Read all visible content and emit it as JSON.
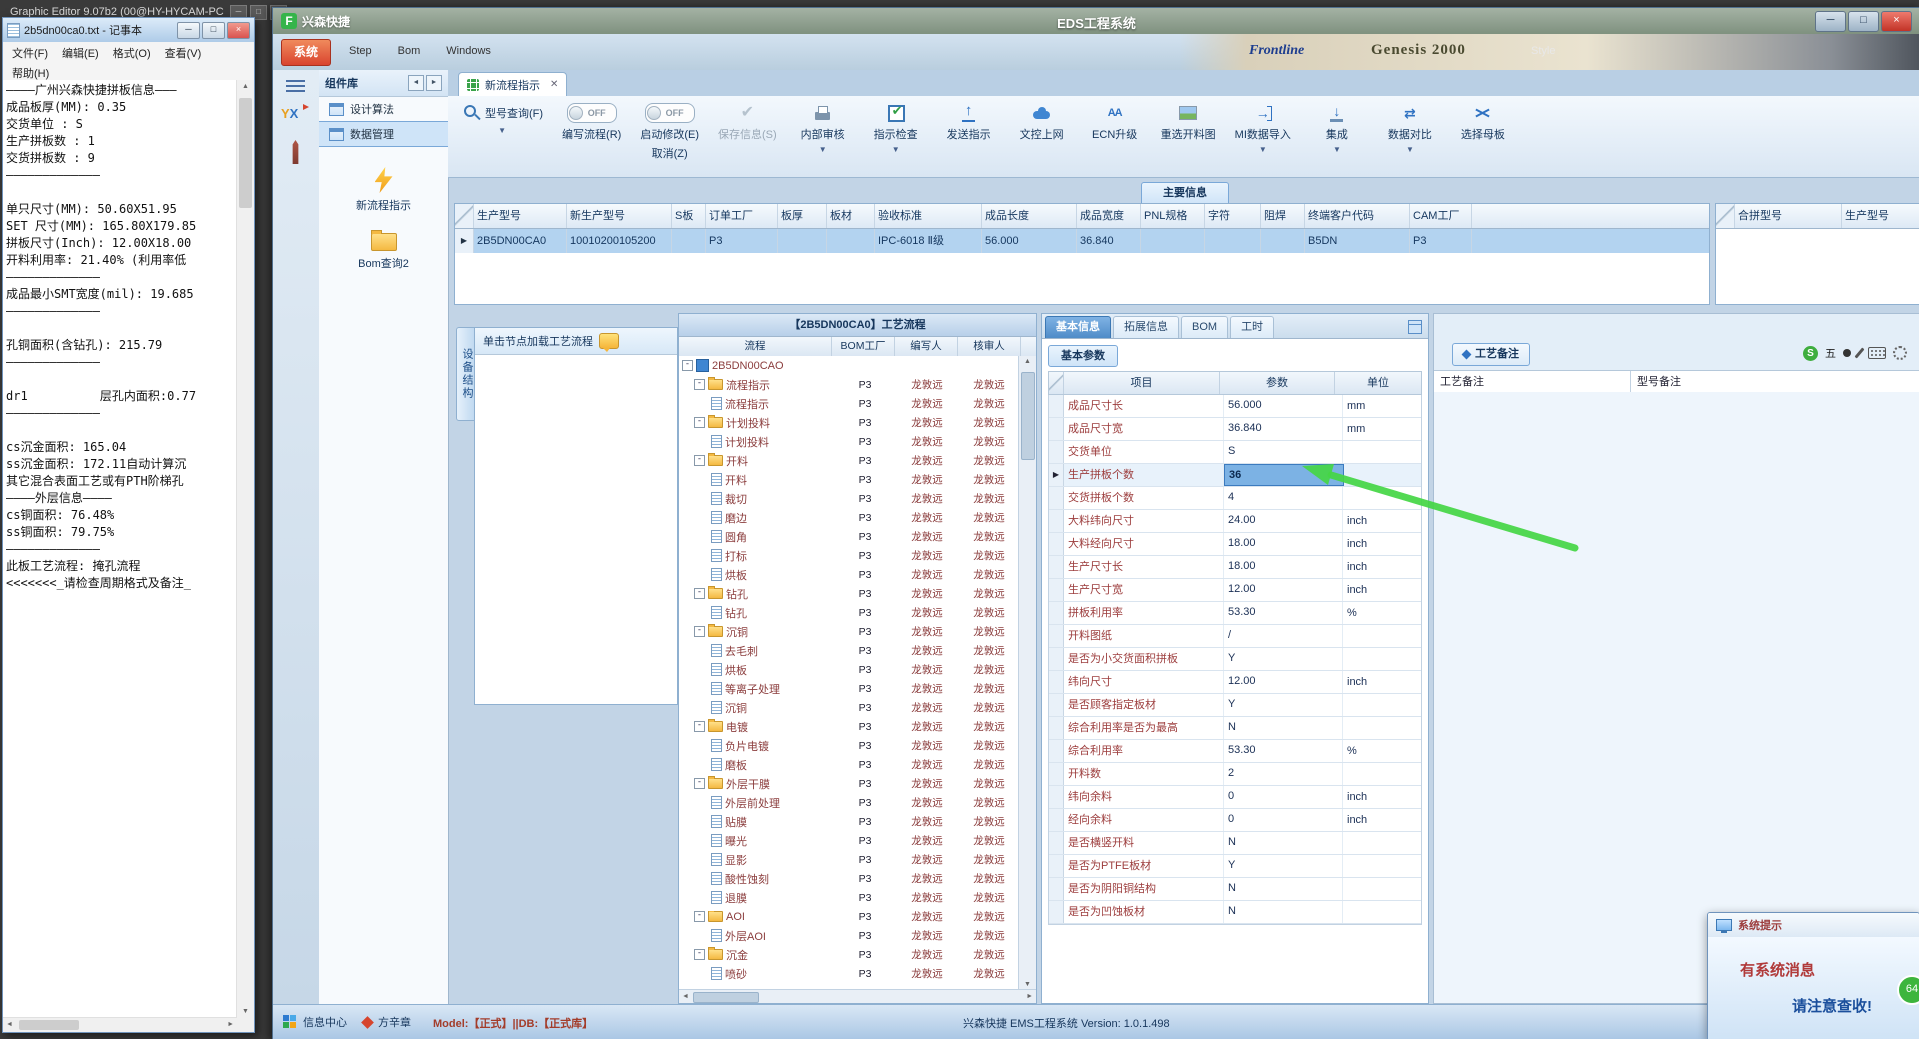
{
  "ge": {
    "title": "Graphic Editor 9.07b2 (00@HY-HYCAM-PC"
  },
  "notepad": {
    "title": "2b5dn00ca0.txt - 记事本",
    "menus": [
      "文件(F)",
      "编辑(E)",
      "格式(O)",
      "查看(V)",
      "帮助(H)"
    ],
    "lines": [
      "————广州兴森快捷拼板信息———",
      "成品板厚(MM): 0.35",
      "交货单位 : S",
      "生产拼板数 : 1",
      "交货拼板数 : 9",
      "—————————————",
      "",
      "单只尺寸(MM): 50.60X51.95",
      "SET 尺寸(MM): 165.80X179.85",
      "拼板尺寸(Inch): 12.00X18.00",
      "开料利用率: 21.40% (利用率低",
      "—————————————",
      "成品最小SMT宽度(mil): 19.685",
      "—————————————",
      "",
      "孔铜面积(含钻孔): 215.79",
      "—————————————",
      "",
      "dr1          层孔内面积:0.77",
      "—————————————",
      "",
      "cs沉金面积: 165.04",
      "ss沉金面积: 172.11自动计算沉",
      "其它混合表面工艺或有PTH阶梯孔",
      "————外层信息————",
      "cs铜面积: 76.48%",
      "ss铜面积: 79.75%",
      "—————————————",
      "此板工艺流程: 掩孔流程",
      "<<<<<<<_请检查周期格式及备注_"
    ]
  },
  "app": {
    "brand_logo": "F",
    "brand": "兴森快捷",
    "title": "EDS工程系统",
    "system_menu": "系统",
    "menu_extras": [
      "Step",
      "Bom",
      "Windows"
    ],
    "banner": {
      "frontline": "Frontline",
      "genesis": "Genesis 2000",
      "style": "Style"
    }
  },
  "library": {
    "title": "组件库",
    "logo_y": "Y",
    "logo_x": "X",
    "tabs": [
      "设计算法",
      "数据管理"
    ],
    "active_tab": "数据管理",
    "items": [
      {
        "label": "新流程指示",
        "icon": "bolt"
      },
      {
        "label": "Bom查询2",
        "icon": "folder"
      }
    ]
  },
  "workspace": {
    "tab": "新流程指示",
    "main_info_label": "主要信息",
    "toolbar": [
      {
        "label": "型号查询(F)",
        "icon": "search",
        "dropdown": true,
        "inline": true
      },
      {
        "label": "编写流程(R)",
        "toggle": "OFF"
      },
      {
        "label": "启动修改(E)",
        "toggle": "OFF",
        "sub": "取消(Z)"
      },
      {
        "label": "保存信息(S)",
        "icon": "save",
        "disabled": true
      },
      {
        "label": "内部审核",
        "icon": "audit",
        "dropdown": true
      },
      {
        "label": "指示检查",
        "icon": "checkbox",
        "dropdown": true
      },
      {
        "label": "发送指示",
        "icon": "send"
      },
      {
        "label": "文控上网",
        "icon": "cloud"
      },
      {
        "label": "ECN升级",
        "icon": "ecn"
      },
      {
        "label": "重选开料图",
        "icon": "image"
      },
      {
        "label": "MI数据导入",
        "icon": "import",
        "dropdown": true
      },
      {
        "label": "集成",
        "icon": "integrate",
        "dropdown": true
      },
      {
        "label": "数据对比",
        "icon": "compare",
        "dropdown": true
      },
      {
        "label": "选择母板",
        "icon": "shuffle"
      }
    ],
    "main_table": {
      "columns": [
        "生产型号",
        "新生产型号",
        "S板",
        "订单工厂",
        "板厚",
        "板材",
        "验收标准",
        "成品长度",
        "成品宽度",
        "PNL规格",
        "字符",
        "阻焊",
        "终端客户代码",
        "CAM工厂"
      ],
      "row": [
        "2B5DN00CA0",
        "10010200105200",
        "",
        "P3",
        "",
        "",
        "IPC-6018 Ⅱ级",
        "56.000",
        "36.840",
        "",
        "",
        "",
        "B5DN",
        "P3"
      ],
      "right_columns": [
        "合拼型号",
        "生产型号"
      ]
    }
  },
  "flow": {
    "device_tab": "设备结构",
    "hint": "单击节点加载工艺流程",
    "title": "【2B5DN00CA0】工艺流程",
    "columns": [
      "流程",
      "BOM工厂",
      "编写人",
      "核审人"
    ],
    "rows": [
      {
        "t": "root",
        "i": 0,
        "l": "2B5DN00CAO",
        "b": "",
        "w": "",
        "a": ""
      },
      {
        "t": "folder",
        "i": 1,
        "l": "流程指示",
        "b": "P3",
        "w": "龙敦远",
        "a": "龙敦远"
      },
      {
        "t": "doc",
        "i": 2,
        "l": "流程指示",
        "b": "P3",
        "w": "龙敦远",
        "a": "龙敦远"
      },
      {
        "t": "folder",
        "i": 1,
        "l": "计划投料",
        "b": "P3",
        "w": "龙敦远",
        "a": "龙敦远"
      },
      {
        "t": "doc",
        "i": 2,
        "l": "计划投料",
        "b": "P3",
        "w": "龙敦远",
        "a": "龙敦远"
      },
      {
        "t": "folder",
        "i": 1,
        "l": "开料",
        "b": "P3",
        "w": "龙敦远",
        "a": "龙敦远"
      },
      {
        "t": "doc",
        "i": 2,
        "l": "开料",
        "b": "P3",
        "w": "龙敦远",
        "a": "龙敦远"
      },
      {
        "t": "doc",
        "i": 2,
        "l": "裁切",
        "b": "P3",
        "w": "龙敦远",
        "a": "龙敦远"
      },
      {
        "t": "doc",
        "i": 2,
        "l": "磨边",
        "b": "P3",
        "w": "龙敦远",
        "a": "龙敦远"
      },
      {
        "t": "doc",
        "i": 2,
        "l": "圆角",
        "b": "P3",
        "w": "龙敦远",
        "a": "龙敦远"
      },
      {
        "t": "doc",
        "i": 2,
        "l": "打标",
        "b": "P3",
        "w": "龙敦远",
        "a": "龙敦远"
      },
      {
        "t": "doc",
        "i": 2,
        "l": "烘板",
        "b": "P3",
        "w": "龙敦远",
        "a": "龙敦远"
      },
      {
        "t": "folder",
        "i": 1,
        "l": "钻孔",
        "b": "P3",
        "w": "龙敦远",
        "a": "龙敦远"
      },
      {
        "t": "doc",
        "i": 2,
        "l": "钻孔",
        "b": "P3",
        "w": "龙敦远",
        "a": "龙敦远"
      },
      {
        "t": "folder",
        "i": 1,
        "l": "沉铜",
        "b": "P3",
        "w": "龙敦远",
        "a": "龙敦远"
      },
      {
        "t": "doc",
        "i": 2,
        "l": "去毛刺",
        "b": "P3",
        "w": "龙敦远",
        "a": "龙敦远"
      },
      {
        "t": "doc",
        "i": 2,
        "l": "烘板",
        "b": "P3",
        "w": "龙敦远",
        "a": "龙敦远"
      },
      {
        "t": "doc",
        "i": 2,
        "l": "等离子处理",
        "b": "P3",
        "w": "龙敦远",
        "a": "龙敦远"
      },
      {
        "t": "doc",
        "i": 2,
        "l": "沉铜",
        "b": "P3",
        "w": "龙敦远",
        "a": "龙敦远"
      },
      {
        "t": "folder",
        "i": 1,
        "l": "电镀",
        "b": "P3",
        "w": "龙敦远",
        "a": "龙敦远"
      },
      {
        "t": "doc",
        "i": 2,
        "l": "负片电镀",
        "b": "P3",
        "w": "龙敦远",
        "a": "龙敦远"
      },
      {
        "t": "doc",
        "i": 2,
        "l": "磨板",
        "b": "P3",
        "w": "龙敦远",
        "a": "龙敦远"
      },
      {
        "t": "folder",
        "i": 1,
        "l": "外层干膜",
        "b": "P3",
        "w": "龙敦远",
        "a": "龙敦远"
      },
      {
        "t": "doc",
        "i": 2,
        "l": "外层前处理",
        "b": "P3",
        "w": "龙敦远",
        "a": "龙敦远"
      },
      {
        "t": "doc",
        "i": 2,
        "l": "贴膜",
        "b": "P3",
        "w": "龙敦远",
        "a": "龙敦远"
      },
      {
        "t": "doc",
        "i": 2,
        "l": "曝光",
        "b": "P3",
        "w": "龙敦远",
        "a": "龙敦远"
      },
      {
        "t": "doc",
        "i": 2,
        "l": "显影",
        "b": "P3",
        "w": "龙敦远",
        "a": "龙敦远"
      },
      {
        "t": "doc",
        "i": 2,
        "l": "酸性蚀刻",
        "b": "P3",
        "w": "龙敦远",
        "a": "龙敦远"
      },
      {
        "t": "doc",
        "i": 2,
        "l": "退膜",
        "b": "P3",
        "w": "龙敦远",
        "a": "龙敦远"
      },
      {
        "t": "folder",
        "i": 1,
        "l": "AOI",
        "b": "P3",
        "w": "龙敦远",
        "a": "龙敦远"
      },
      {
        "t": "doc",
        "i": 2,
        "l": "外层AOI",
        "b": "P3",
        "w": "龙敦远",
        "a": "龙敦远"
      },
      {
        "t": "folder",
        "i": 1,
        "l": "沉金",
        "b": "P3",
        "w": "龙敦远",
        "a": "龙敦远"
      },
      {
        "t": "doc",
        "i": 2,
        "l": "喷砂",
        "b": "P3",
        "w": "龙敦远",
        "a": "龙敦远"
      }
    ]
  },
  "details": {
    "tabs": [
      "基本信息",
      "拓展信息",
      "BOM",
      "工时"
    ],
    "active_tab": "基本信息",
    "subtab": "基本参数",
    "columns": [
      "项目",
      "参数",
      "单位"
    ],
    "selected_index": 3,
    "rows": [
      {
        "item": "成品尺寸长",
        "value": "56.000",
        "unit": "mm"
      },
      {
        "item": "成品尺寸宽",
        "value": "36.840",
        "unit": "mm"
      },
      {
        "item": "交货单位",
        "value": "S",
        "unit": ""
      },
      {
        "item": "生产拼板个数",
        "value": "36",
        "unit": ""
      },
      {
        "item": "交货拼板个数",
        "value": "4",
        "unit": ""
      },
      {
        "item": "大料纬向尺寸",
        "value": "24.00",
        "unit": "inch"
      },
      {
        "item": "大料经向尺寸",
        "value": "18.00",
        "unit": "inch"
      },
      {
        "item": "生产尺寸长",
        "value": "18.00",
        "unit": "inch"
      },
      {
        "item": "生产尺寸宽",
        "value": "12.00",
        "unit": "inch"
      },
      {
        "item": "拼板利用率",
        "value": "53.30",
        "unit": "%"
      },
      {
        "item": "开料图纸",
        "value": "/",
        "unit": ""
      },
      {
        "item": "是否为小交货面积拼板",
        "value": "Y",
        "unit": ""
      },
      {
        "item": "纬向尺寸",
        "value": "12.00",
        "unit": "inch"
      },
      {
        "item": "是否顾客指定板材",
        "value": "Y",
        "unit": ""
      },
      {
        "item": "综合利用率是否为最高",
        "value": "N",
        "unit": ""
      },
      {
        "item": "综合利用率",
        "value": "53.30",
        "unit": "%"
      },
      {
        "item": "开料数",
        "value": "2",
        "unit": ""
      },
      {
        "item": "纬向余料",
        "value": "0",
        "unit": "inch"
      },
      {
        "item": "经向余料",
        "value": "0",
        "unit": "inch"
      },
      {
        "item": "是否横竖开料",
        "value": "N",
        "unit": ""
      },
      {
        "item": "是否为PTFE板材",
        "value": "Y",
        "unit": ""
      },
      {
        "item": "是否为阴阳铜结构",
        "value": "N",
        "unit": ""
      },
      {
        "item": "是否为凹蚀板材",
        "value": "N",
        "unit": ""
      }
    ]
  },
  "notes": {
    "tab": "工艺备注",
    "columns": [
      "工艺备注",
      "型号备注"
    ],
    "ime": {
      "sogou": "S",
      "wubi": "五"
    }
  },
  "statusbar": {
    "info_center": "信息中心",
    "user": "方辛章",
    "model": "Model:【正式】||DB:【正式库】",
    "version": "兴森快捷  EMS工程系统  Version: 1.0.1.498"
  },
  "popup": {
    "title": "系统提示",
    "line1": "有系统消息",
    "line2": "请注意查收!",
    "badge": "64"
  }
}
